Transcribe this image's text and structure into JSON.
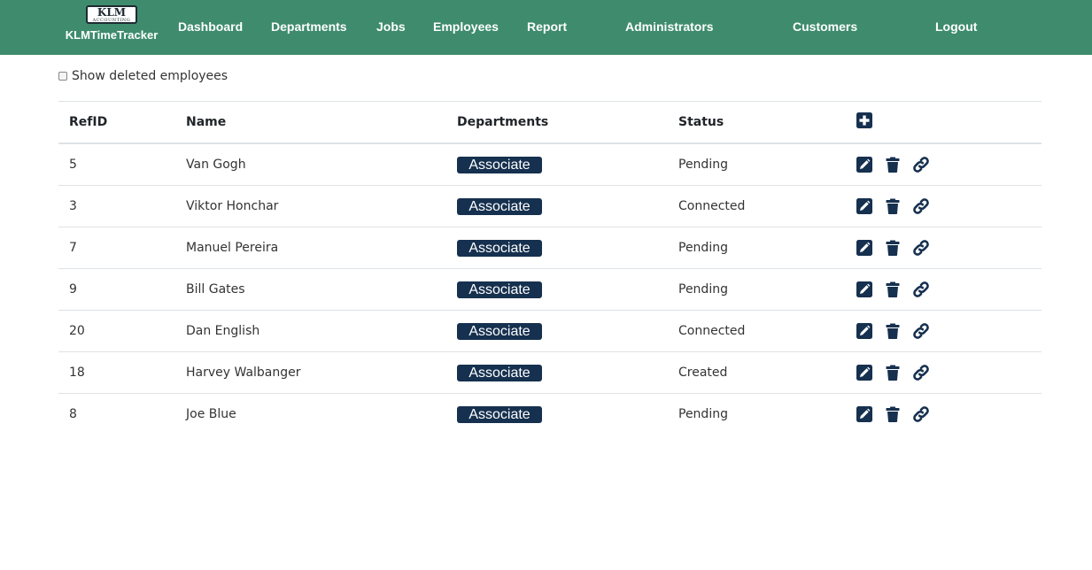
{
  "brand": {
    "logo_main": "KLM",
    "logo_sub": "ACCOUNTING",
    "name": "KLMTimeTracker"
  },
  "nav": {
    "dashboard": "Dashboard",
    "departments": "Departments",
    "jobs": "Jobs",
    "employees": "Employees",
    "report": "Report",
    "administrators": "Administrators",
    "customers": "Customers",
    "logout": "Logout"
  },
  "filters": {
    "show_deleted_label": "Show deleted employees"
  },
  "table": {
    "headers": {
      "refid": "RefID",
      "name": "Name",
      "departments": "Departments",
      "status": "Status"
    },
    "rows": [
      {
        "refid": "5",
        "name": "Van Gogh",
        "department": "Associate",
        "status": "Pending"
      },
      {
        "refid": "3",
        "name": "Viktor Honchar",
        "department": "Associate",
        "status": "Connected"
      },
      {
        "refid": "7",
        "name": "Manuel Pereira",
        "department": "Associate",
        "status": "Pending"
      },
      {
        "refid": "9",
        "name": "Bill Gates",
        "department": "Associate",
        "status": "Pending"
      },
      {
        "refid": "20",
        "name": "Dan English",
        "department": "Associate",
        "status": "Connected"
      },
      {
        "refid": "18",
        "name": "Harvey Walbanger",
        "department": "Associate",
        "status": "Created"
      },
      {
        "refid": "8",
        "name": "Joe Blue",
        "department": "Associate",
        "status": "Pending"
      }
    ]
  },
  "colors": {
    "navbar": "#3e8c6d",
    "badge": "#16304f",
    "icon": "#16304f"
  },
  "icons": {
    "add": "plus-square-icon",
    "edit": "edit-icon",
    "delete": "trash-icon",
    "link": "link-icon"
  }
}
